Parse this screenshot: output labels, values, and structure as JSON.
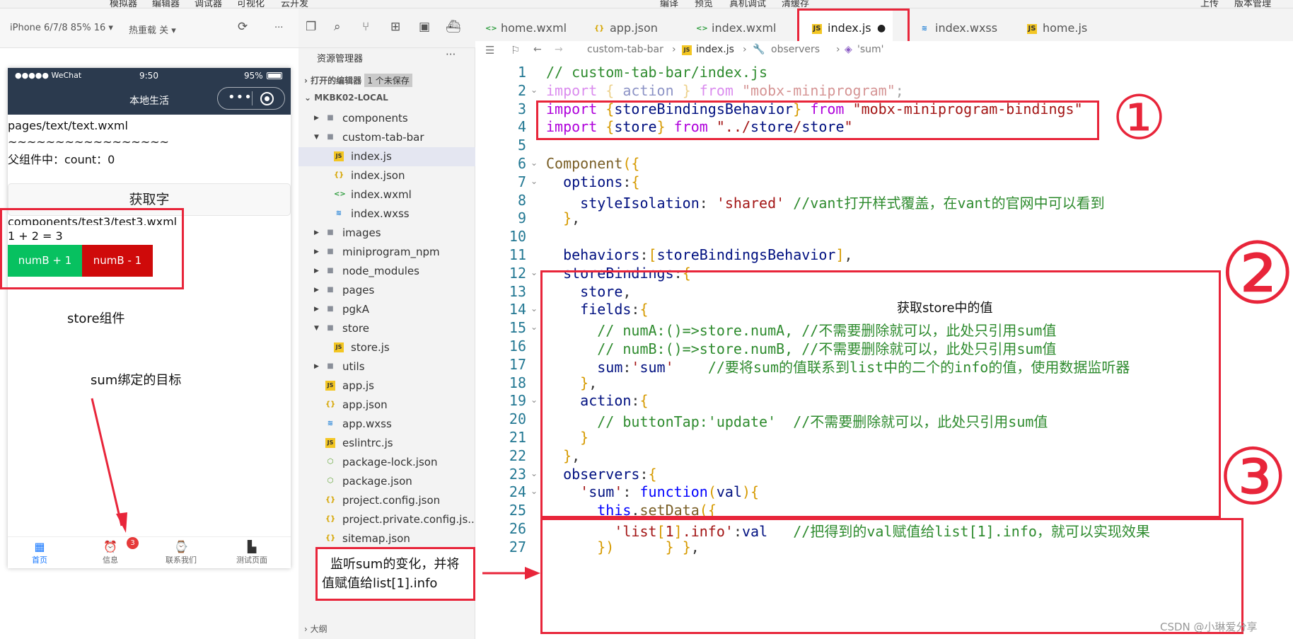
{
  "menubar": [
    "模拟器",
    "编辑器",
    "调试器",
    "可视化",
    "云开发",
    "编译",
    "预览",
    "真机调试",
    "清缓存",
    "上传",
    "版本管理"
  ],
  "simulator": {
    "device": "iPhone 6/7/8 85% 16 ▾",
    "hotreload": "热重载 关 ▾",
    "status_left": "●●●●● WeChat",
    "status_time": "9:50",
    "status_battery": "95%",
    "nav_title": "本地生活",
    "lines": [
      "pages/text/text.wxml",
      "~~~~~~~~~~~~~~~~~",
      "父组件中：count：0"
    ],
    "get_button": "获取字",
    "test3_path": "components/test3/test3.wxml",
    "sum_text": "1 + 2 = 3",
    "btn_plus": "numB + 1",
    "btn_minus": "numB - 1",
    "tabs": [
      {
        "label": "首页",
        "icon": "calendar-icon"
      },
      {
        "label": "信息",
        "icon": "alarm-icon"
      },
      {
        "label": "联系我们",
        "icon": "watch-icon"
      },
      {
        "label": "测试页面",
        "icon": "city-icon"
      }
    ],
    "badge": "3"
  },
  "annotations": {
    "store_component": "store组件",
    "sum_target": "sum绑定的目标",
    "listen_line1": "监听sum的变化，并将",
    "listen_line2": "值赋值给list[1].info",
    "get_store": "获取store中的值",
    "circle1": "①",
    "circle2": "②",
    "circle3": "③"
  },
  "explorer": {
    "title": "资源管理器",
    "more": "···",
    "open_editors": "打开的编辑器",
    "unsaved": "1 个未保存",
    "project": "MKBK02-LOCAL",
    "outline": "大纲",
    "items": [
      {
        "name": "components",
        "type": "folder",
        "depth": 1,
        "open": false
      },
      {
        "name": "custom-tab-bar",
        "type": "folder",
        "depth": 1,
        "open": true
      },
      {
        "name": "index.js",
        "type": "js",
        "depth": 2,
        "selected": true
      },
      {
        "name": "index.json",
        "type": "json",
        "depth": 2
      },
      {
        "name": "index.wxml",
        "type": "wxml",
        "depth": 2
      },
      {
        "name": "index.wxss",
        "type": "wxss",
        "depth": 2
      },
      {
        "name": "images",
        "type": "folder",
        "depth": 1,
        "open": false
      },
      {
        "name": "miniprogram_npm",
        "type": "folder",
        "depth": 1,
        "open": false
      },
      {
        "name": "node_modules",
        "type": "folder",
        "depth": 1,
        "open": false
      },
      {
        "name": "pages",
        "type": "folder",
        "depth": 1,
        "open": false
      },
      {
        "name": "pgkA",
        "type": "folder",
        "depth": 1,
        "open": false
      },
      {
        "name": "store",
        "type": "folder",
        "depth": 1,
        "open": true
      },
      {
        "name": "store.js",
        "type": "js",
        "depth": 2
      },
      {
        "name": "utils",
        "type": "folder",
        "depth": 1,
        "open": false
      },
      {
        "name": "app.js",
        "type": "js",
        "depth": 1
      },
      {
        "name": "app.json",
        "type": "json",
        "depth": 1
      },
      {
        "name": "app.wxss",
        "type": "wxss",
        "depth": 1
      },
      {
        "name": "eslintrc.js",
        "type": "js",
        "depth": 1
      },
      {
        "name": "package-lock.json",
        "type": "pkg",
        "depth": 1
      },
      {
        "name": "package.json",
        "type": "pkg",
        "depth": 1
      },
      {
        "name": "project.config.json",
        "type": "json",
        "depth": 1
      },
      {
        "name": "project.private.config.js...",
        "type": "json",
        "depth": 1
      },
      {
        "name": "sitemap.json",
        "type": "json",
        "depth": 1
      }
    ]
  },
  "editor_tabs": [
    {
      "name": "home.wxml",
      "type": "wxml"
    },
    {
      "name": "app.json",
      "type": "json"
    },
    {
      "name": "index.wxml",
      "type": "wxml"
    },
    {
      "name": "index.js",
      "type": "js",
      "active": true,
      "dirty": "●"
    },
    {
      "name": "index.wxss",
      "type": "wxss"
    },
    {
      "name": "home.js",
      "type": "js"
    }
  ],
  "breadcrumb": [
    "custom-tab-bar",
    "index.js",
    "observers",
    "'sum'"
  ],
  "code_lines": [
    {
      "n": "1",
      "t": "// custom-tab-bar/index.js"
    },
    {
      "n": "2",
      "t": "import { action } from \"mobx-miniprogram\";"
    },
    {
      "n": "3",
      "t": "import {storeBindingsBehavior} from \"mobx-miniprogram-bindings\""
    },
    {
      "n": "4",
      "t": "import {store} from \"../store/store\""
    },
    {
      "n": "5",
      "t": ""
    },
    {
      "n": "6",
      "t": "Component({"
    },
    {
      "n": "7",
      "t": "  options:{"
    },
    {
      "n": "8",
      "t": "    styleIsolation: 'shared' //vant打开样式覆盖，在vant的官网中可以看到"
    },
    {
      "n": "9",
      "t": "  },"
    },
    {
      "n": "10",
      "t": ""
    },
    {
      "n": "11",
      "t": "  behaviors:[storeBindingsBehavior],"
    },
    {
      "n": "12",
      "t": "  storeBindings:{"
    },
    {
      "n": "13",
      "t": "    store,"
    },
    {
      "n": "14",
      "t": "    fields:{"
    },
    {
      "n": "15",
      "t": "      // numA:()=>store.numA, //不需要删除就可以，此处只引用sum值"
    },
    {
      "n": "16",
      "t": "      // numB:()=>store.numB, //不需要删除就可以，此处只引用sum值"
    },
    {
      "n": "17",
      "t": "      sum:'sum'    //要将sum的值联系到list中的二个的info的值，使用数据监听器"
    },
    {
      "n": "18",
      "t": "    },"
    },
    {
      "n": "19",
      "t": "    action:{"
    },
    {
      "n": "20",
      "t": "      // buttonTap:'update'  //不需要删除就可以，此处只引用sum值"
    },
    {
      "n": "21",
      "t": "    }"
    },
    {
      "n": "22",
      "t": "  },"
    },
    {
      "n": "23",
      "t": "  observers:{"
    },
    {
      "n": "24",
      "t": "    'sum': function(val){"
    },
    {
      "n": "25",
      "t": "      this.setData({"
    },
    {
      "n": "26",
      "t": "        'list[1].info':val   //把得到的val赋值给list[1].info，就可以实现效果"
    },
    {
      "n": "27",
      "t": "      })      } },"
    }
  ],
  "watermark": "CSDN @小琳爱分享"
}
